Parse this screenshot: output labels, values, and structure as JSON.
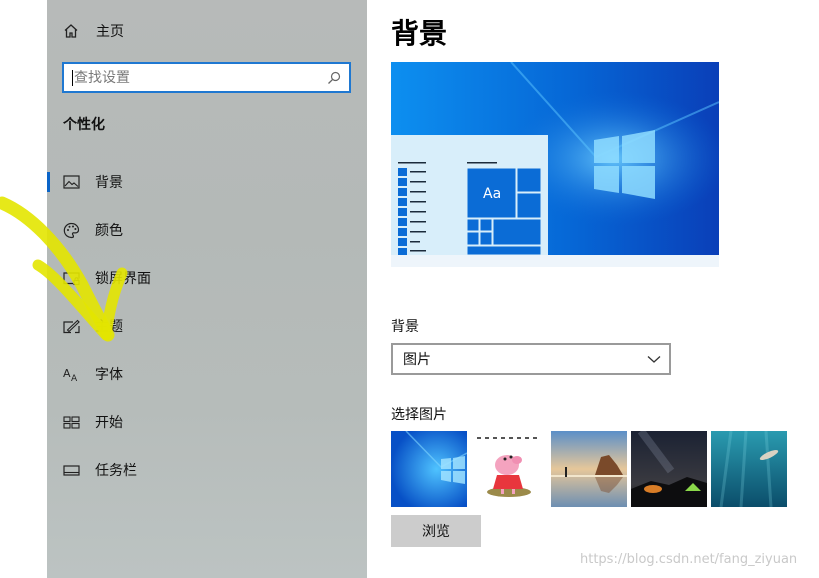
{
  "sidebar": {
    "home_label": "主页",
    "search": {
      "placeholder": "查找设置"
    },
    "section_title": "个性化",
    "items": [
      {
        "label": "背景",
        "icon": "picture-icon",
        "active": true
      },
      {
        "label": "颜色",
        "icon": "palette-icon",
        "active": false
      },
      {
        "label": "锁屏界面",
        "icon": "lock-screen-icon",
        "active": false
      },
      {
        "label": "主题",
        "icon": "theme-icon",
        "active": false
      },
      {
        "label": "字体",
        "icon": "font-icon",
        "active": false
      },
      {
        "label": "开始",
        "icon": "start-icon",
        "active": false
      },
      {
        "label": "任务栏",
        "icon": "taskbar-icon",
        "active": false
      }
    ]
  },
  "main": {
    "title": "背景",
    "preview": {
      "tile_text": "Aa"
    },
    "background_label": "背景",
    "background_value": "图片",
    "choose_picture_label": "选择图片",
    "thumbnails": [
      {
        "icon": "windows-hero-wallpaper-icon"
      },
      {
        "icon": "peppa-pig-sticker-icon"
      },
      {
        "icon": "beach-rocks-wallpaper-icon"
      },
      {
        "icon": "night-sky-tent-wallpaper-icon"
      },
      {
        "icon": "underwater-swimmer-wallpaper-icon"
      }
    ],
    "browse_label": "浏览"
  },
  "watermark": "https://blog.csdn.net/fang_ziyuan",
  "colors": {
    "accent": "#0a64c8",
    "scribble": "#e3e600",
    "sidebar_bg": "#b7bab9",
    "button_bg": "#cccccc"
  }
}
